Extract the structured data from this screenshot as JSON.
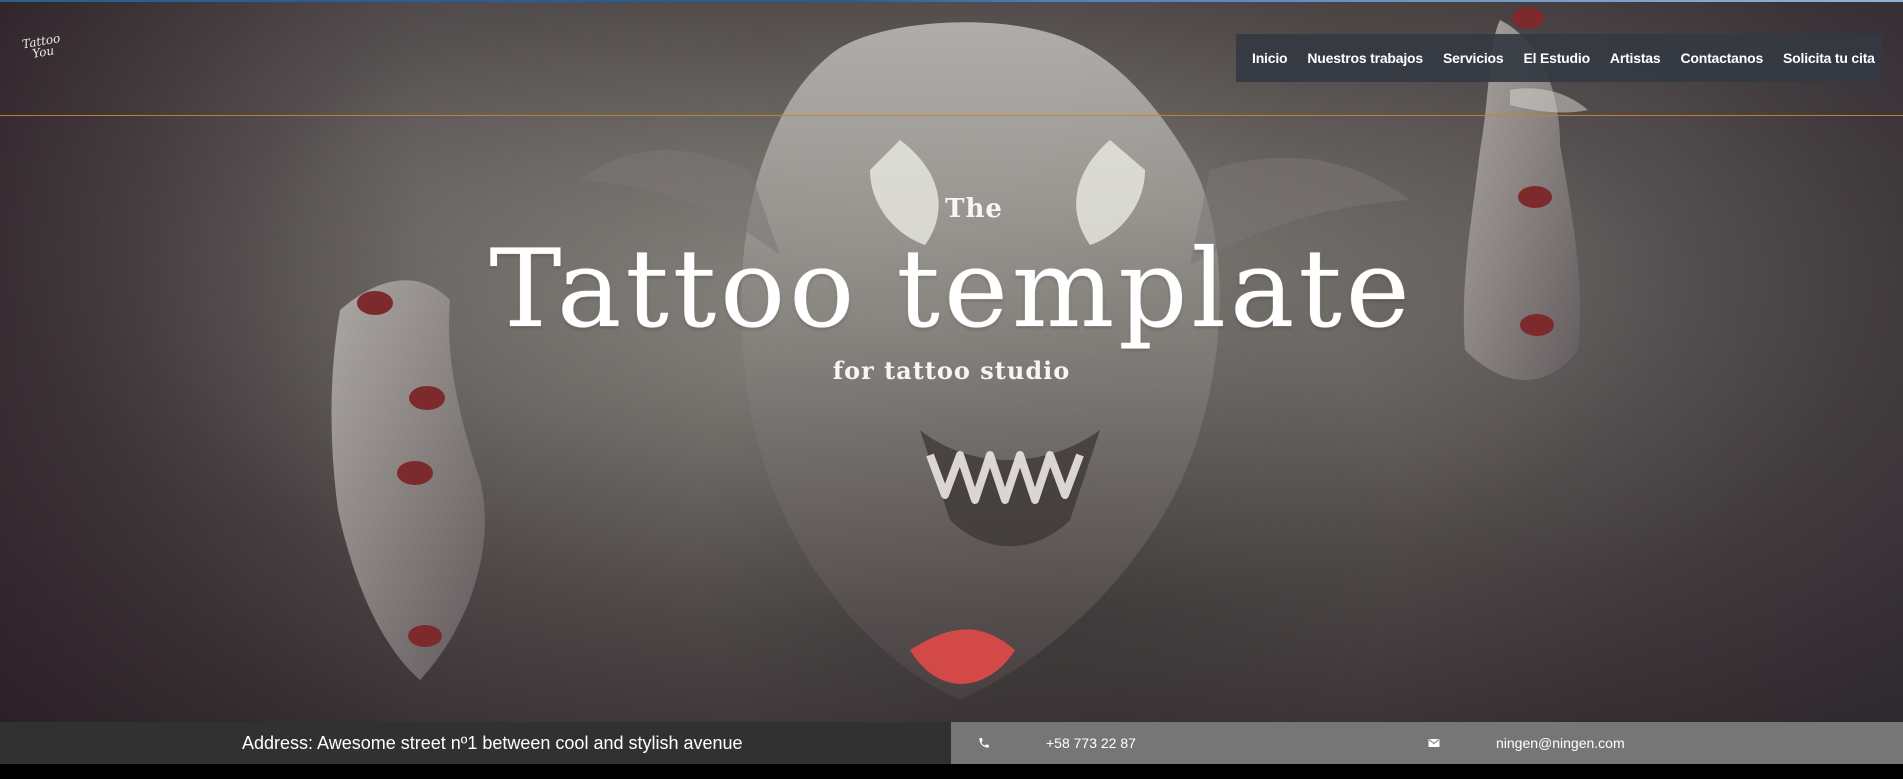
{
  "brand": {
    "logo_text": "Tattoo You"
  },
  "navigation": {
    "items": [
      "Inicio",
      "Nuestros trabajos",
      "Servicios",
      "El Estudio",
      "Artistas",
      "Contactanos",
      "Solicita tu cita"
    ]
  },
  "hero": {
    "pretitle": "The",
    "title": "Tattoo template",
    "subtitle": "for tattoo studio"
  },
  "contact_bar": {
    "address": "Address: Awesome street nº1 between cool and stylish avenue",
    "phone": "+58 773 22 87",
    "email": "ningen@ningen.com"
  },
  "icons": {
    "phone": "phone-icon",
    "email": "email-icon"
  },
  "colors": {
    "nav_background": "#343A42",
    "accent_rule": "#CC7D2D",
    "address_bar": "#313131",
    "contact_bar": "#767676"
  }
}
